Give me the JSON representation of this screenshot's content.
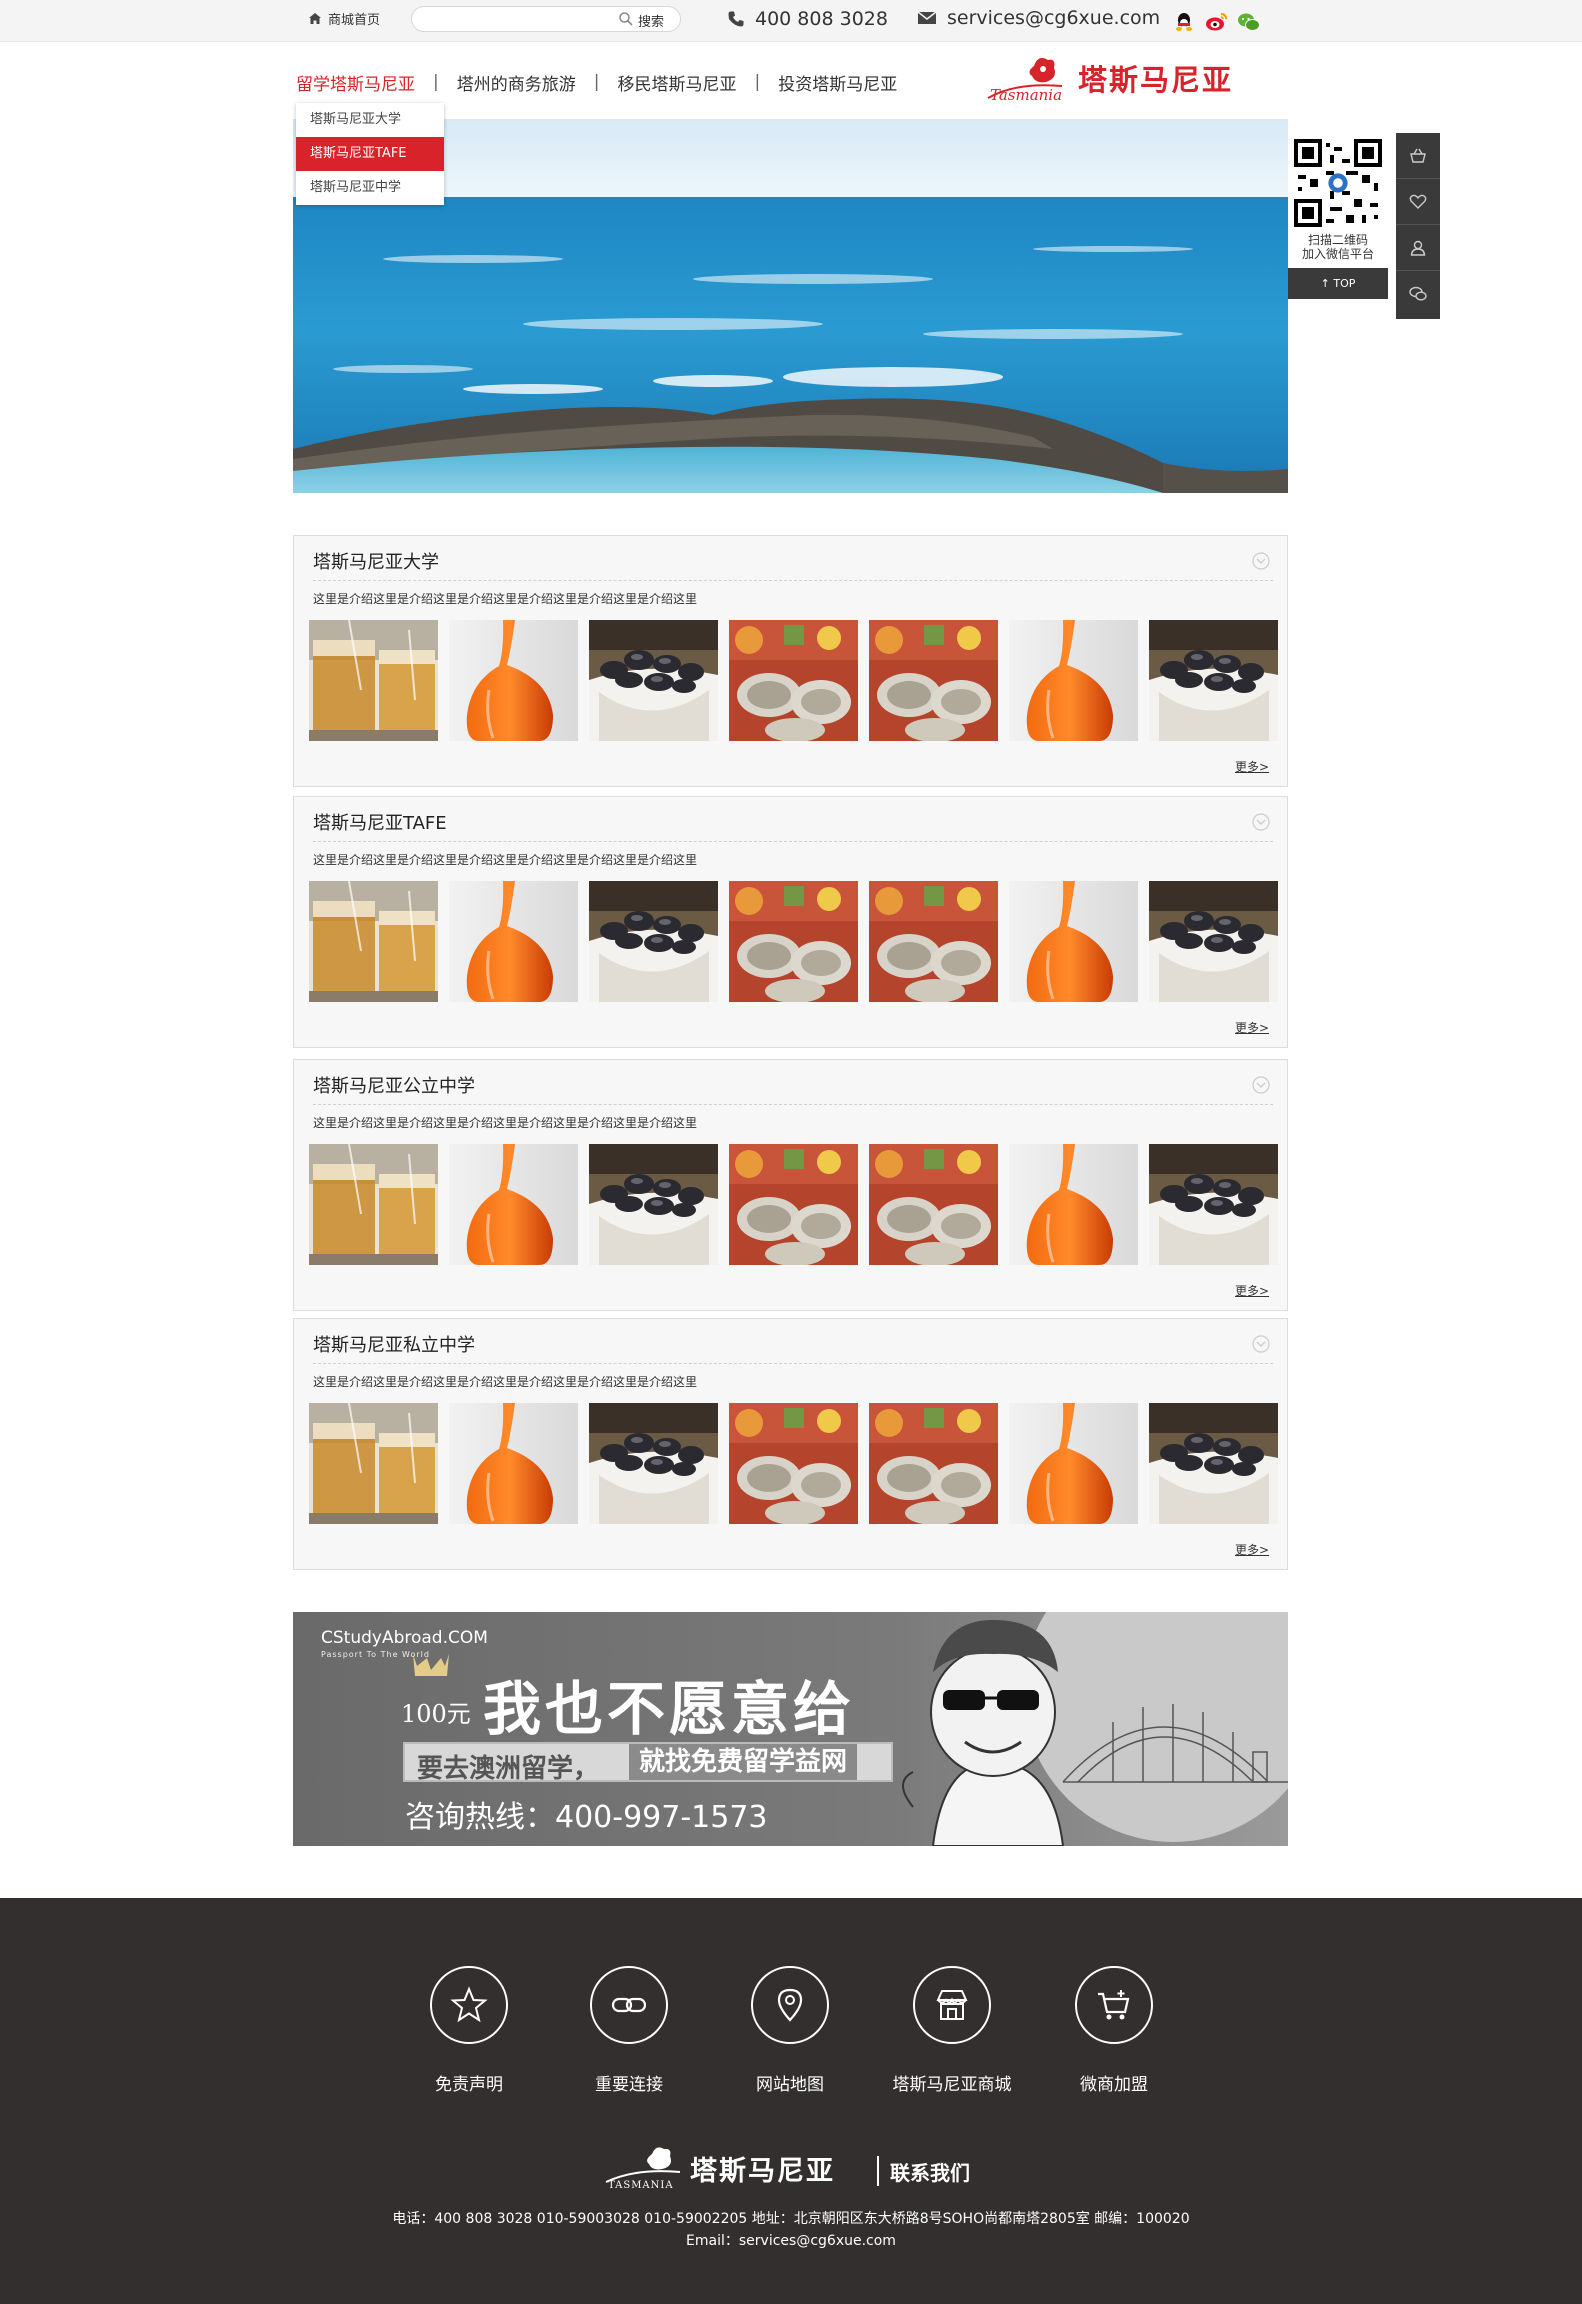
{
  "topbar": {
    "home_label": "商城首页",
    "search_placeholder": "",
    "search_button": "搜索",
    "phone": "400 808 3028",
    "email": "services@cg6xue.com",
    "social_icons": [
      "qq-icon",
      "weibo-icon",
      "wechat-icon"
    ]
  },
  "nav": {
    "items": [
      {
        "label": "留学塔斯马尼亚",
        "active": true
      },
      {
        "label": "塔州的商务旅游",
        "active": false
      },
      {
        "label": "移民塔斯马尼亚",
        "active": false
      },
      {
        "label": "投资塔斯马尼亚",
        "active": false
      }
    ],
    "separator": "|",
    "dropdown": [
      {
        "label": "塔斯马尼亚大学",
        "active": false
      },
      {
        "label": "塔斯马尼亚TAFE",
        "active": true
      },
      {
        "label": "塔斯马尼亚中学",
        "active": false
      }
    ]
  },
  "logo": {
    "text": "塔斯马尼亚",
    "script": "Tasmania"
  },
  "side_tools": {
    "qr_text_line1": "扫描二维码",
    "qr_text_line2": "加入微信平台",
    "top_label": "TOP",
    "icons": [
      "basket-icon",
      "heart-icon",
      "user-icon",
      "chat-icon"
    ]
  },
  "sections": [
    {
      "title": "塔斯马尼亚大学",
      "desc": "这里是介绍这里是介绍这里是介绍这里是介绍这里是介绍这里是介绍这里",
      "more": "更多>"
    },
    {
      "title": "塔斯马尼亚TAFE",
      "desc": "这里是介绍这里是介绍这里是介绍这里是介绍这里是介绍这里是介绍这里",
      "more": "更多>"
    },
    {
      "title": "塔斯马尼亚公立中学",
      "desc": "这里是介绍这里是介绍这里是介绍这里是介绍这里是介绍这里是介绍这里",
      "more": "更多>"
    },
    {
      "title": "塔斯马尼亚私立中学",
      "desc": "这里是介绍这里是介绍这里是介绍这里是介绍这里是介绍这里是介绍这里",
      "more": "更多>"
    }
  ],
  "thumbnails": [
    "tea-glass",
    "orange-vase",
    "mussels-bowl",
    "oysters-plate",
    "oysters-plate",
    "orange-vase",
    "mussels-bowl"
  ],
  "ad": {
    "brand": "CStudyAbroad.COM",
    "brand_sub": "Passport To The World",
    "price": "100元",
    "headline": "我也不愿意给",
    "strip_a": "要去澳洲留学，",
    "strip_b": "就找免费留学益网",
    "hotline": "咨询热线：400-997-1573"
  },
  "footer": {
    "links": [
      {
        "label": "免责声明",
        "icon": "star-icon"
      },
      {
        "label": "重要连接",
        "icon": "link-icon"
      },
      {
        "label": "网站地图",
        "icon": "map-pin-icon"
      },
      {
        "label": "塔斯马尼亚商城",
        "icon": "shop-icon"
      },
      {
        "label": "微商加盟",
        "icon": "cart-icon"
      }
    ],
    "logo_text": "塔斯马尼亚",
    "logo_script": "TASMANIA",
    "contact_us": "联系我们",
    "contact_line": "电话：400 808 3028   010-59003028   010-59002205   地址：北京朝阳区东大桥路8号SOHO尚都南塔2805室   邮编：100020",
    "email_line": "Email：services@cg6xue.com"
  },
  "colors": {
    "accent": "#d8232a",
    "footer_bg": "#332f2e",
    "sidebar_bg": "#3a3a3a"
  }
}
